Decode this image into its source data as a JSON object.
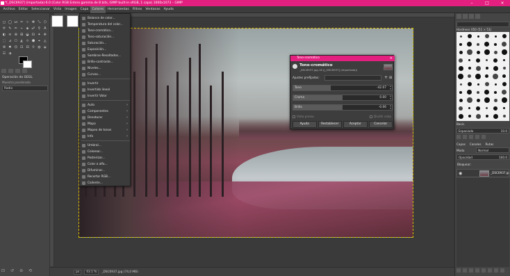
{
  "window": {
    "title": "*[_DSC6937] (importada)-6.0 (Color RGB Entero gamma de 8 bits, GIMP built-in sRGB, 1 capa) 1600x1073 – GIMP",
    "minimize": "–",
    "maximize": "□",
    "close": "×"
  },
  "menubar": [
    "Archivo",
    "Editar",
    "Seleccionar",
    "Vista",
    "Imagen",
    "Capa",
    "Colores",
    "Herramientas",
    "Filtros",
    "Ventanas",
    "Ayuda"
  ],
  "tool_options": {
    "title": "Operación de GEGL",
    "subtitle": "Muestra ponderada",
    "radius_field": "Radio"
  },
  "colors_menu": {
    "items": [
      {
        "label": "Balance de color...",
        "submenu": false
      },
      {
        "label": "Temperatura del color...",
        "submenu": false
      },
      {
        "label": "Tono-cromático...",
        "submenu": false
      },
      {
        "label": "Tono-saturación...",
        "submenu": false
      },
      {
        "label": "Saturación...",
        "submenu": false
      },
      {
        "label": "Exposición...",
        "submenu": false
      },
      {
        "label": "Sombras-Resaltados...",
        "submenu": false
      },
      {
        "label": "Brillo-contraste...",
        "submenu": false
      },
      {
        "label": "Niveles...",
        "submenu": false
      },
      {
        "label": "Curvas...",
        "submenu": false
      },
      {
        "label": "Invertir",
        "submenu": false
      },
      {
        "label": "Invertido lineal",
        "submenu": false
      },
      {
        "label": "Invertir Valor",
        "submenu": false
      },
      {
        "label": "Auto",
        "submenu": true
      },
      {
        "label": "Componentes",
        "submenu": true
      },
      {
        "label": "Desaturar",
        "submenu": true
      },
      {
        "label": "Mapa",
        "submenu": true
      },
      {
        "label": "Mapeo de tonos",
        "submenu": true
      },
      {
        "label": "Info",
        "submenu": true
      },
      {
        "label": "Umbral...",
        "submenu": false
      },
      {
        "label": "Colorear...",
        "submenu": false
      },
      {
        "label": "Posterizar...",
        "submenu": false
      },
      {
        "label": "Color a alfa...",
        "submenu": false
      },
      {
        "label": "Difuminar...",
        "submenu": false
      },
      {
        "label": "Recortar RGB...",
        "submenu": false
      },
      {
        "label": "Caliente...",
        "submenu": false
      }
    ]
  },
  "dialog": {
    "window_title": "Tono-cromático",
    "heading": "Tono-cromático",
    "subheading": "_DSC6937.jpg-16 ([_DSC6937] (importada))",
    "presets_label": "Ajustes prefijados:",
    "add_symbol": "+",
    "menu_symbol": "⊞",
    "sliders": [
      {
        "label": "Tono",
        "value": "-42.07",
        "fill": 0.38
      },
      {
        "label": "Croma",
        "value": "0.00",
        "fill": 0.5
      },
      {
        "label": "Brillo",
        "value": "-0.06",
        "fill": 0.5
      }
    ],
    "preview_label": "Vista previa",
    "split_label": "Dividir vista",
    "buttons": {
      "help": "Ayuda",
      "reset": "Restablecer",
      "ok": "Aceptar",
      "cancel": "Cancelar"
    },
    "close": "×"
  },
  "right_panel": {
    "brush_name": "Hardness 050 (51 × 51)",
    "filter_label": "Basic.",
    "spacing_label": "Espaciado",
    "spacing_value": "10.0",
    "tabs_label": "Capas",
    "channels_label": "Canales",
    "paths_label": "Rutas",
    "mode_label": "Modo",
    "mode_value": "Normal",
    "opacity_label": "Opacidad",
    "opacity_value": "100.0",
    "lock_label": "Bloquear:",
    "layer_name": "_DSC6937.jp"
  },
  "statusbar": {
    "unit": "px",
    "zoom": "43.1 %",
    "file_info": "_DSC6937.jpg (74,0 MB)"
  }
}
